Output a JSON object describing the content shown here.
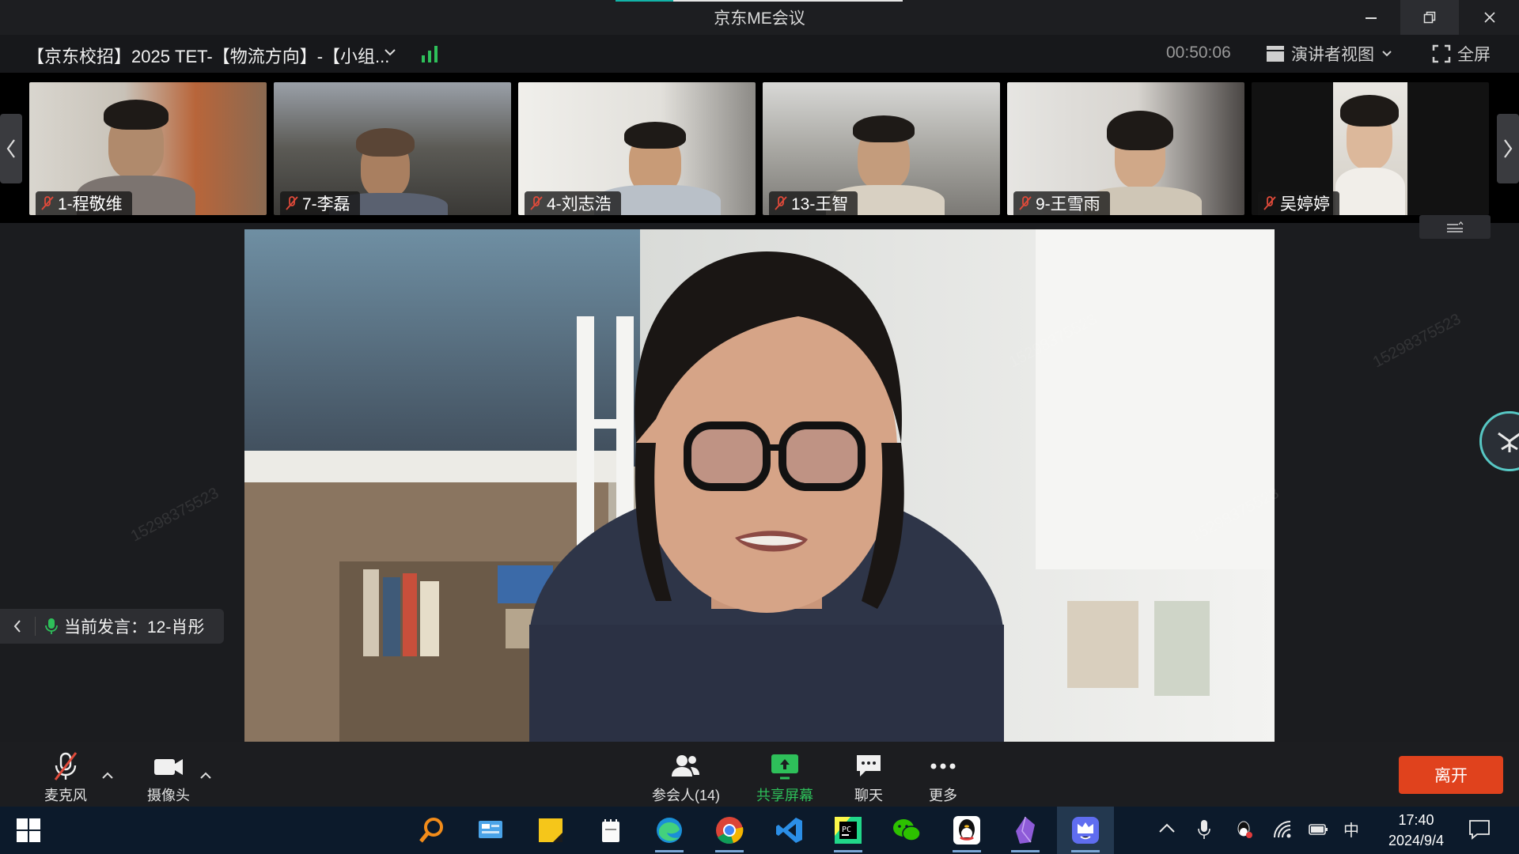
{
  "window": {
    "app_title": "京东ME会议",
    "controls": [
      "minimize-icon",
      "restore-icon",
      "close-icon"
    ]
  },
  "meeting": {
    "title": "【京东校招】2025 TET-【物流方向】-【小组...",
    "elapsed": "00:50:06",
    "view_mode": "演讲者视图",
    "fullscreen": "全屏"
  },
  "participants_strip": [
    {
      "name": "1-程敬维",
      "muted": true
    },
    {
      "name": "7-李磊",
      "muted": true
    },
    {
      "name": "4-刘志浩",
      "muted": true
    },
    {
      "name": "13-王智",
      "muted": true
    },
    {
      "name": "9-王雪雨",
      "muted": true
    },
    {
      "name": "吴婷婷",
      "muted": true
    }
  ],
  "speaker": {
    "label": "当前发言：12-肖彤"
  },
  "toolbar": {
    "mic": "麦克风",
    "camera": "摄像头",
    "participants": "参会人(14)",
    "share": "共享屏幕",
    "chat": "聊天",
    "more": "更多",
    "leave": "离开"
  },
  "taskbar": {
    "apps": [
      "search-icon",
      "control-panel-icon",
      "sticky-notes-icon",
      "notepad-icon",
      "edge-icon",
      "chrome-icon",
      "vscode-icon",
      "pycharm-icon",
      "wechat-icon",
      "qq-icon",
      "obsidian-icon",
      "meeting-app-icon"
    ],
    "ime": "中",
    "time": "17:40",
    "date": "2024/9/4"
  },
  "colors": {
    "share_green": "#2ec05a",
    "leave_red": "#e0421d",
    "muted_red": "#e04a3a",
    "speaking_green": "#2ec05a"
  },
  "watermark": "15298375523"
}
